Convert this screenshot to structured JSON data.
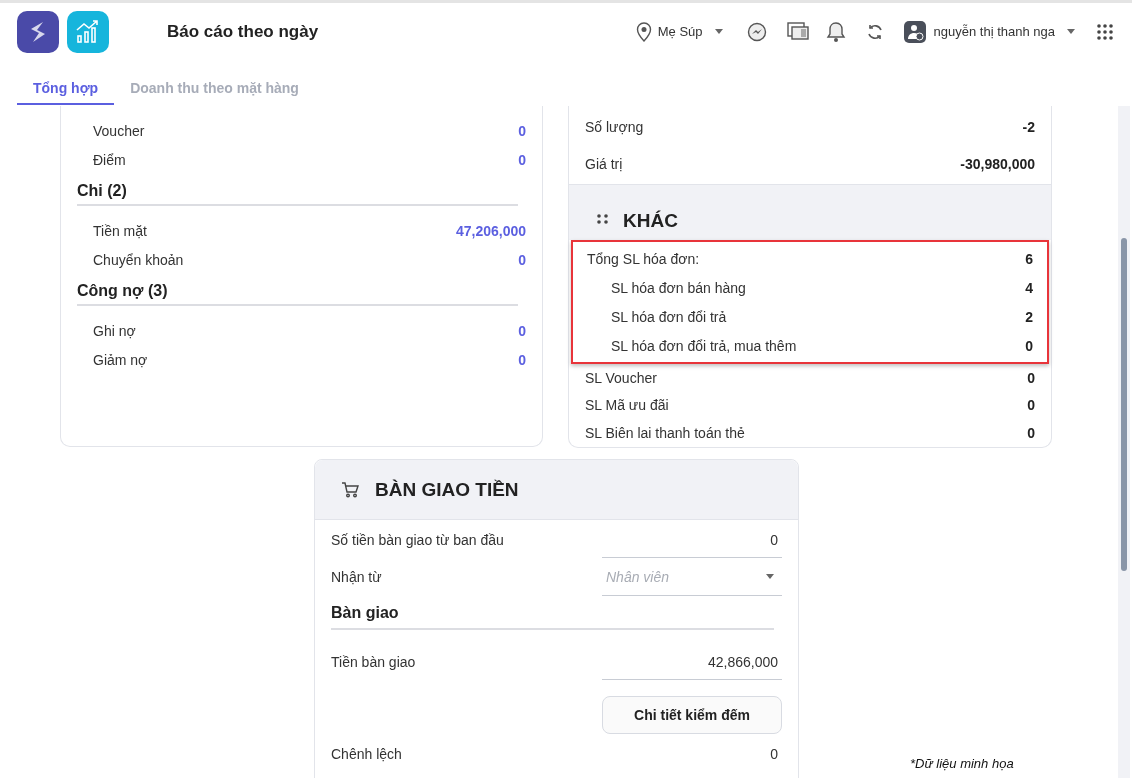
{
  "header": {
    "title": "Báo cáo theo ngày",
    "store": "Mẹ Súp",
    "user": "nguyễn thị thanh nga"
  },
  "tabs": [
    {
      "label": "Tổng hợp",
      "selected": true
    },
    {
      "label": "Doanh thu theo mặt hàng",
      "selected": false
    }
  ],
  "payment_card": {
    "rows": [
      {
        "label": "Voucher",
        "value": "0"
      },
      {
        "label": "Điểm",
        "value": "0"
      }
    ],
    "sections": [
      {
        "title": "Chi (2)",
        "rows": [
          {
            "label": "Tiền mặt",
            "value": "47,206,000"
          },
          {
            "label": "Chuyển khoản",
            "value": "0"
          }
        ]
      },
      {
        "title": "Công nợ (3)",
        "rows": [
          {
            "label": "Ghi nợ",
            "value": "0"
          },
          {
            "label": "Giảm nợ",
            "value": "0"
          }
        ]
      }
    ]
  },
  "returns_card": {
    "rows": [
      {
        "label": "Số lượng",
        "value": "-2"
      },
      {
        "label": "Giá trị",
        "value": "-30,980,000"
      }
    ],
    "khac": {
      "title": "KHÁC",
      "rows": [
        {
          "label": "Tổng SL hóa đơn:",
          "value": "6",
          "indented": false,
          "highlighted": true
        },
        {
          "label": "SL hóa đơn bán hàng",
          "value": "4",
          "indented": true,
          "highlighted": true
        },
        {
          "label": "SL hóa đơn đổi trả",
          "value": "2",
          "indented": true,
          "highlighted": true
        },
        {
          "label": "SL hóa đơn đổi trả, mua thêm",
          "value": "0",
          "indented": true,
          "highlighted": true
        },
        {
          "label": "SL Voucher",
          "value": "0",
          "indented": false,
          "highlighted": false
        },
        {
          "label": "SL Mã ưu đãi",
          "value": "0",
          "indented": false,
          "highlighted": false
        },
        {
          "label": "SL Biên lai thanh toán thẻ",
          "value": "0",
          "indented": false,
          "highlighted": false
        }
      ]
    }
  },
  "handover": {
    "title": "BÀN GIAO TIỀN",
    "items": [
      {
        "kind": "field",
        "label": "Số tiền bàn giao từ ban đầu",
        "value": "0"
      },
      {
        "kind": "dropdown",
        "label": "Nhận từ",
        "placeholder": "Nhân viên"
      },
      {
        "kind": "heading",
        "label": "Bàn giao"
      },
      {
        "kind": "field",
        "label": "Tiền bàn giao",
        "value": "42,866,000"
      },
      {
        "kind": "button",
        "label": "Chi tiết kiểm đếm"
      },
      {
        "kind": "plain",
        "label": "Chênh lệch",
        "value": "0"
      }
    ]
  },
  "footnote": "*Dữ liệu minh họa"
}
